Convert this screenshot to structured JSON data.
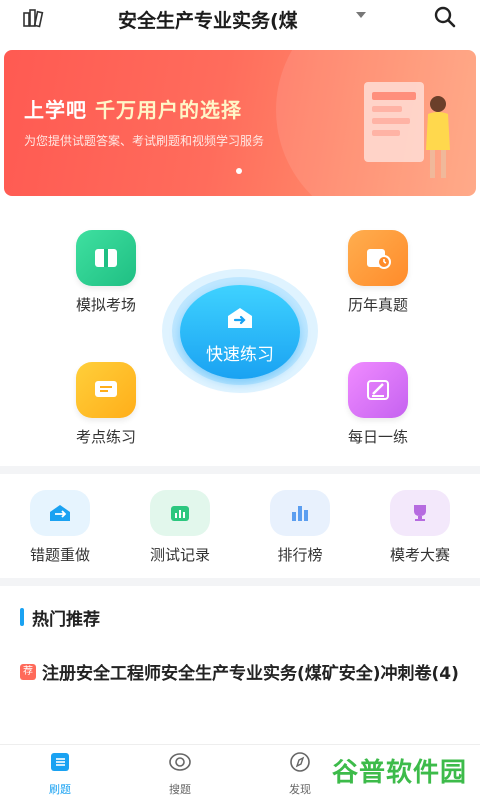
{
  "header": {
    "title": "安全生产专业实务(煤",
    "left_icon": "books-icon",
    "search_icon": "search-icon"
  },
  "banner": {
    "title_a": "上学吧",
    "title_b": "千万用户的选择",
    "subtitle": "为您提供试题答案、考试刷题和视频学习服务"
  },
  "grid": {
    "mock_exam": "模拟考场",
    "past_papers": "历年真题",
    "quick_practice": "快速练习",
    "topic_practice": "考点练习",
    "daily_practice": "每日一练"
  },
  "tools": [
    {
      "label": "错题重做",
      "icon": "redo-icon"
    },
    {
      "label": "测试记录",
      "icon": "bar-chart-icon"
    },
    {
      "label": "排行榜",
      "icon": "ranking-icon"
    },
    {
      "label": "模考大赛",
      "icon": "trophy-icon"
    }
  ],
  "hot": {
    "title": "热门推荐",
    "tag": "荐",
    "item": "注册安全工程师安全生产专业实务(煤矿安全)冲刺卷(4)"
  },
  "nav": {
    "items": [
      {
        "label": "刷题",
        "active": true
      },
      {
        "label": "搜题",
        "active": false
      },
      {
        "label": "发现",
        "active": false
      }
    ]
  },
  "watermark": {
    "text": "谷普软件园"
  },
  "colors": {
    "accent": "#1aa2f2",
    "banner": "#ff5a52",
    "watermark": "#3dbb4a"
  }
}
